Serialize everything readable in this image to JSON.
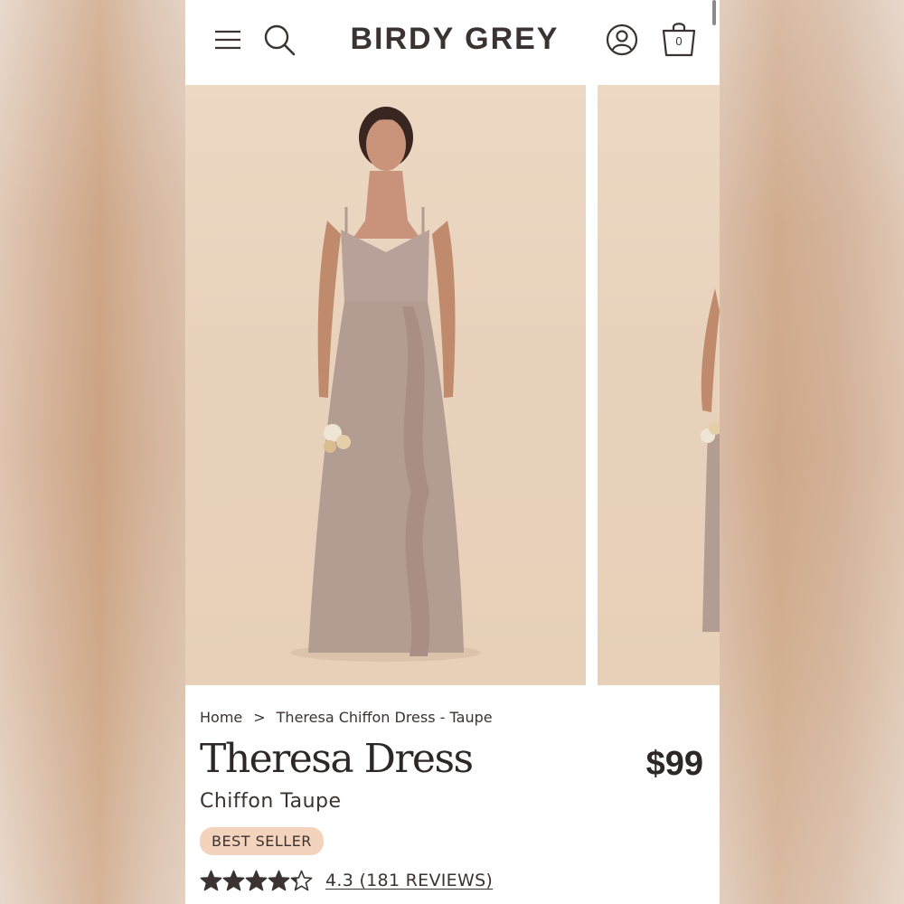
{
  "header": {
    "logo": "BIRDY GREY",
    "cart_count": "0",
    "icons": [
      "menu-icon",
      "search-icon",
      "account-icon",
      "shopping-bag-icon"
    ]
  },
  "gallery": {
    "slides": [
      {
        "label": "product-photo-front",
        "position": "1"
      },
      {
        "label": "product-photo-side",
        "position": "2"
      }
    ]
  },
  "breadcrumb": {
    "home": "Home",
    "separator": ">",
    "current": "Theresa Chiffon Dress - Taupe"
  },
  "product": {
    "title": "Theresa Dress",
    "subtitle": "Chiffon Taupe",
    "price": "$99",
    "badge": "BEST SELLER",
    "rating_value": 4.3,
    "rating_text": "4.3 (181 REVIEWS)"
  },
  "colors": {
    "text": "#3b3232",
    "badge_bg": "#f3d3bc",
    "photo_bg": "#e9d2bc",
    "dress": "#b39c92"
  }
}
